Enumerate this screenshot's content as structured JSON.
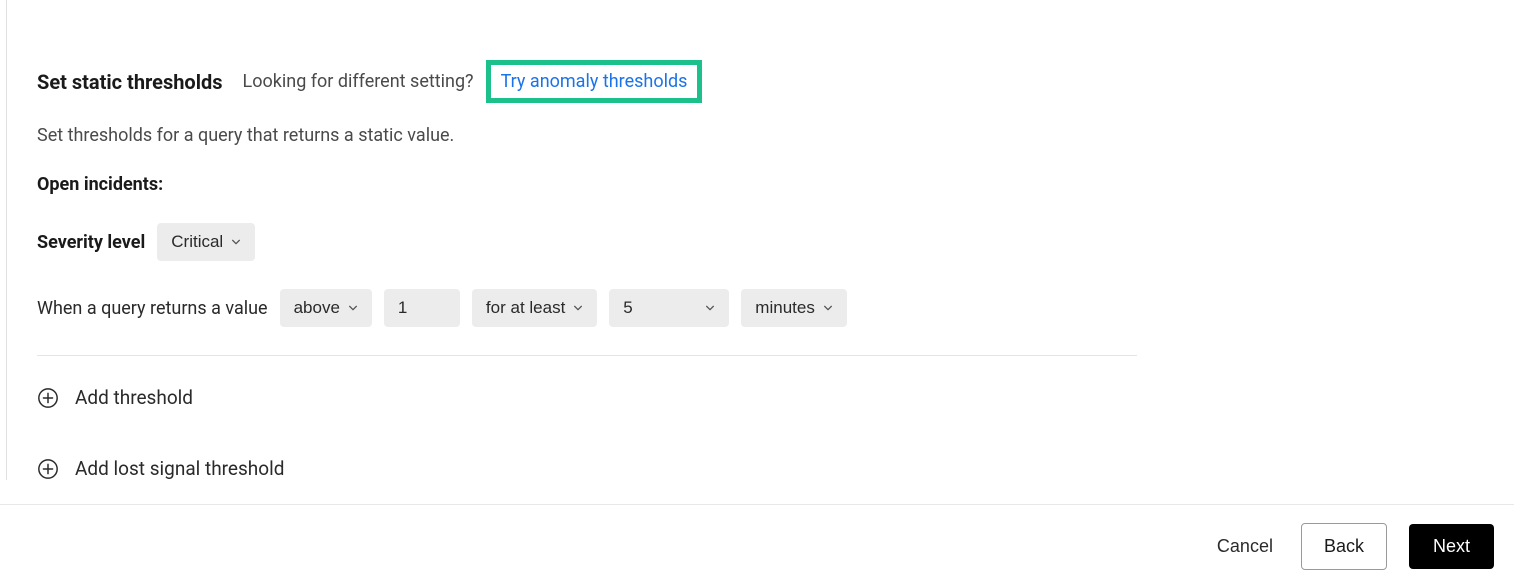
{
  "header": {
    "title": "Set static thresholds",
    "prompt": "Looking for different setting?",
    "link": "Try anomaly thresholds"
  },
  "description": "Set thresholds for a query that returns a static value.",
  "open_incidents_label": "Open incidents:",
  "severity": {
    "label": "Severity level",
    "value": "Critical"
  },
  "condition": {
    "prefix": "When a query returns a value",
    "comparator": "above",
    "threshold_value": "1",
    "duration_mode": "for at least",
    "duration_value": "5",
    "duration_unit": "minutes"
  },
  "actions": {
    "add_threshold": "Add threshold",
    "add_lost_signal": "Add lost signal threshold"
  },
  "footer": {
    "cancel": "Cancel",
    "back": "Back",
    "next": "Next"
  }
}
